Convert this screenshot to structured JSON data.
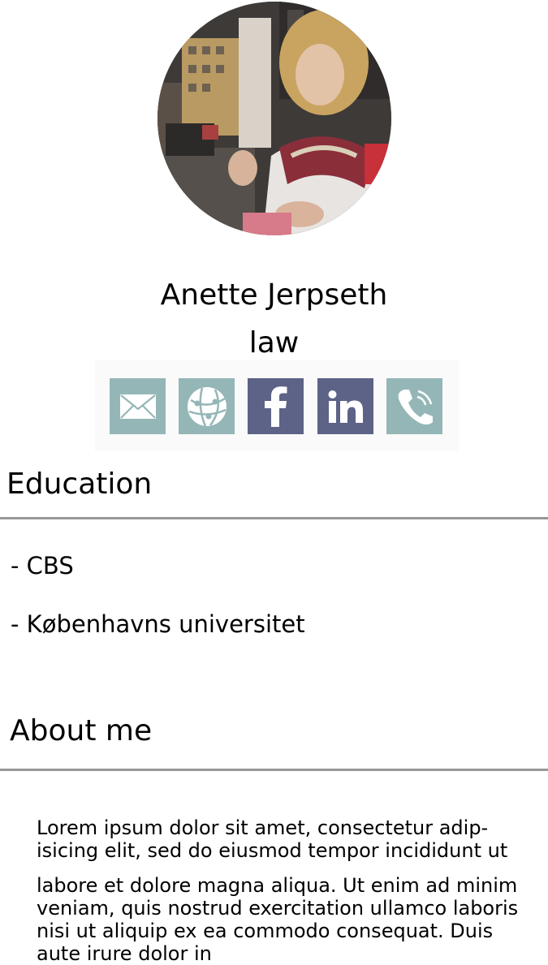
{
  "profile": {
    "name": "Anette Jerpseth",
    "role": "law",
    "photo_alt": "profile photo"
  },
  "social": [
    {
      "id": "email",
      "icon": "envelope-icon",
      "color": "#95b6b6"
    },
    {
      "id": "website",
      "icon": "globe-icon",
      "color": "#95b6b6"
    },
    {
      "id": "facebook",
      "icon": "facebook-icon",
      "color": "#5d6287"
    },
    {
      "id": "linkedin",
      "icon": "linkedin-icon",
      "color": "#5d6287"
    },
    {
      "id": "phone",
      "icon": "phone-icon",
      "color": "#95b6b6"
    }
  ],
  "education": {
    "title": "Education",
    "items": [
      "- CBS",
      "- Københavns universitet"
    ]
  },
  "about": {
    "title": "About me",
    "paragraphs": [
      "Lorem ipsum dolor sit amet, consectetur adip-isicing elit, sed do eiusmod tempor incididunt ut",
      "labore et dolore magna aliqua.  Ut enim ad minim veniam, quis nostrud exercitation ullamco laboris nisi ut aliquip ex ea commodo consequat. Duis aute irure dolor in"
    ]
  }
}
